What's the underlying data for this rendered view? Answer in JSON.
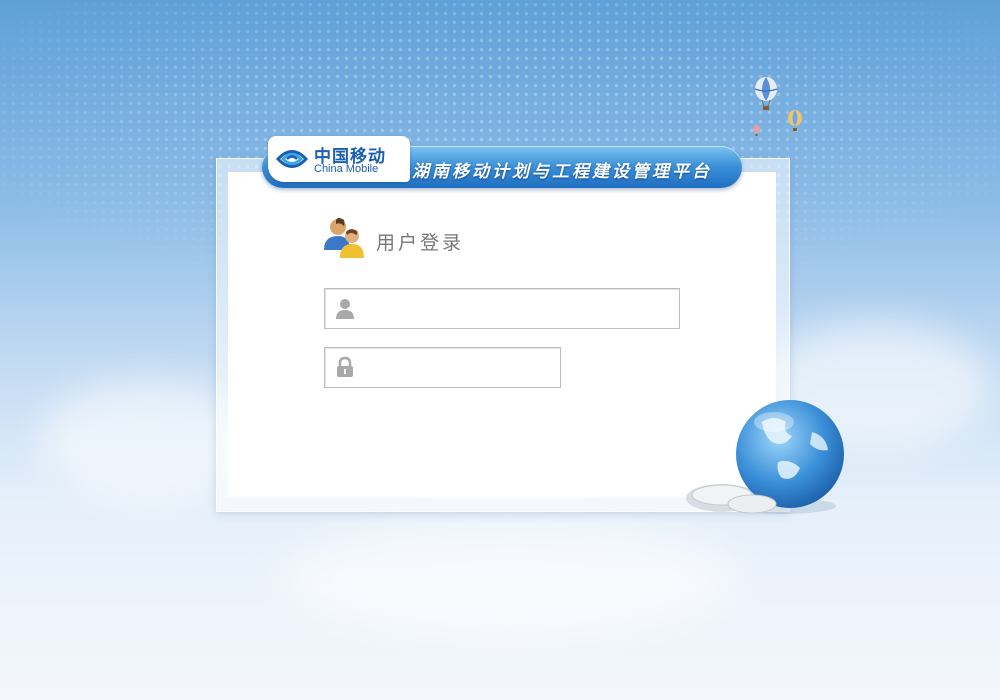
{
  "brand": {
    "logo_cn": "中国移动",
    "logo_en": "China Mobile",
    "platform_title": "湖南移动计划与工程建设管理平台"
  },
  "login": {
    "title": "用户登录",
    "username": {
      "value": "",
      "placeholder": "",
      "icon": "user-icon"
    },
    "password": {
      "value": "",
      "placeholder": "",
      "icon": "lock-icon"
    }
  },
  "decorations": [
    "world-map-dots",
    "hot-air-balloons",
    "globe-icon",
    "clouds"
  ]
}
